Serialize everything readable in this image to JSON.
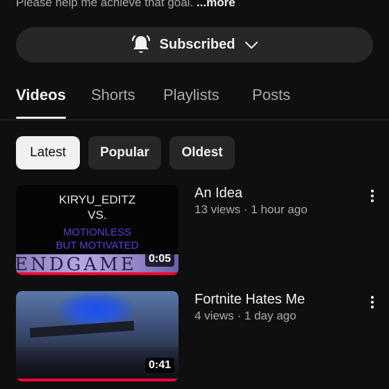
{
  "channel": {
    "description_snippet": "Please help me achieve that goal.",
    "more_label": "...more"
  },
  "subscribe": {
    "label": "Subscribed",
    "bell_icon": "bell-icon",
    "chevron_icon": "chevron-down-icon"
  },
  "tabs": [
    {
      "label": "Videos",
      "active": true
    },
    {
      "label": "Shorts",
      "active": false
    },
    {
      "label": "Playlists",
      "active": false
    },
    {
      "label": "Posts",
      "active": false
    }
  ],
  "filters": [
    {
      "label": "Latest",
      "selected": true
    },
    {
      "label": "Popular",
      "selected": false
    },
    {
      "label": "Oldest",
      "selected": false
    }
  ],
  "videos": [
    {
      "title": "An Idea",
      "meta": "13 views · 1 hour ago",
      "duration": "0:05",
      "thumbnail_text": [
        "KIRYU_EDITZ",
        "VS.",
        "MOTIONLESS",
        "BUT MOTIVATED",
        "ENDGAME"
      ]
    },
    {
      "title": "Fortnite Hates Me",
      "meta": "4 views · 1 day ago",
      "duration": "0:41"
    }
  ],
  "colors": {
    "background": "#0f0f0f",
    "surface": "#272727",
    "text_primary": "#f1f1f1",
    "text_secondary": "#aaaaaa",
    "progress_red": "#ff0033",
    "thumbnail_purple_text": "#5b3fd6"
  }
}
